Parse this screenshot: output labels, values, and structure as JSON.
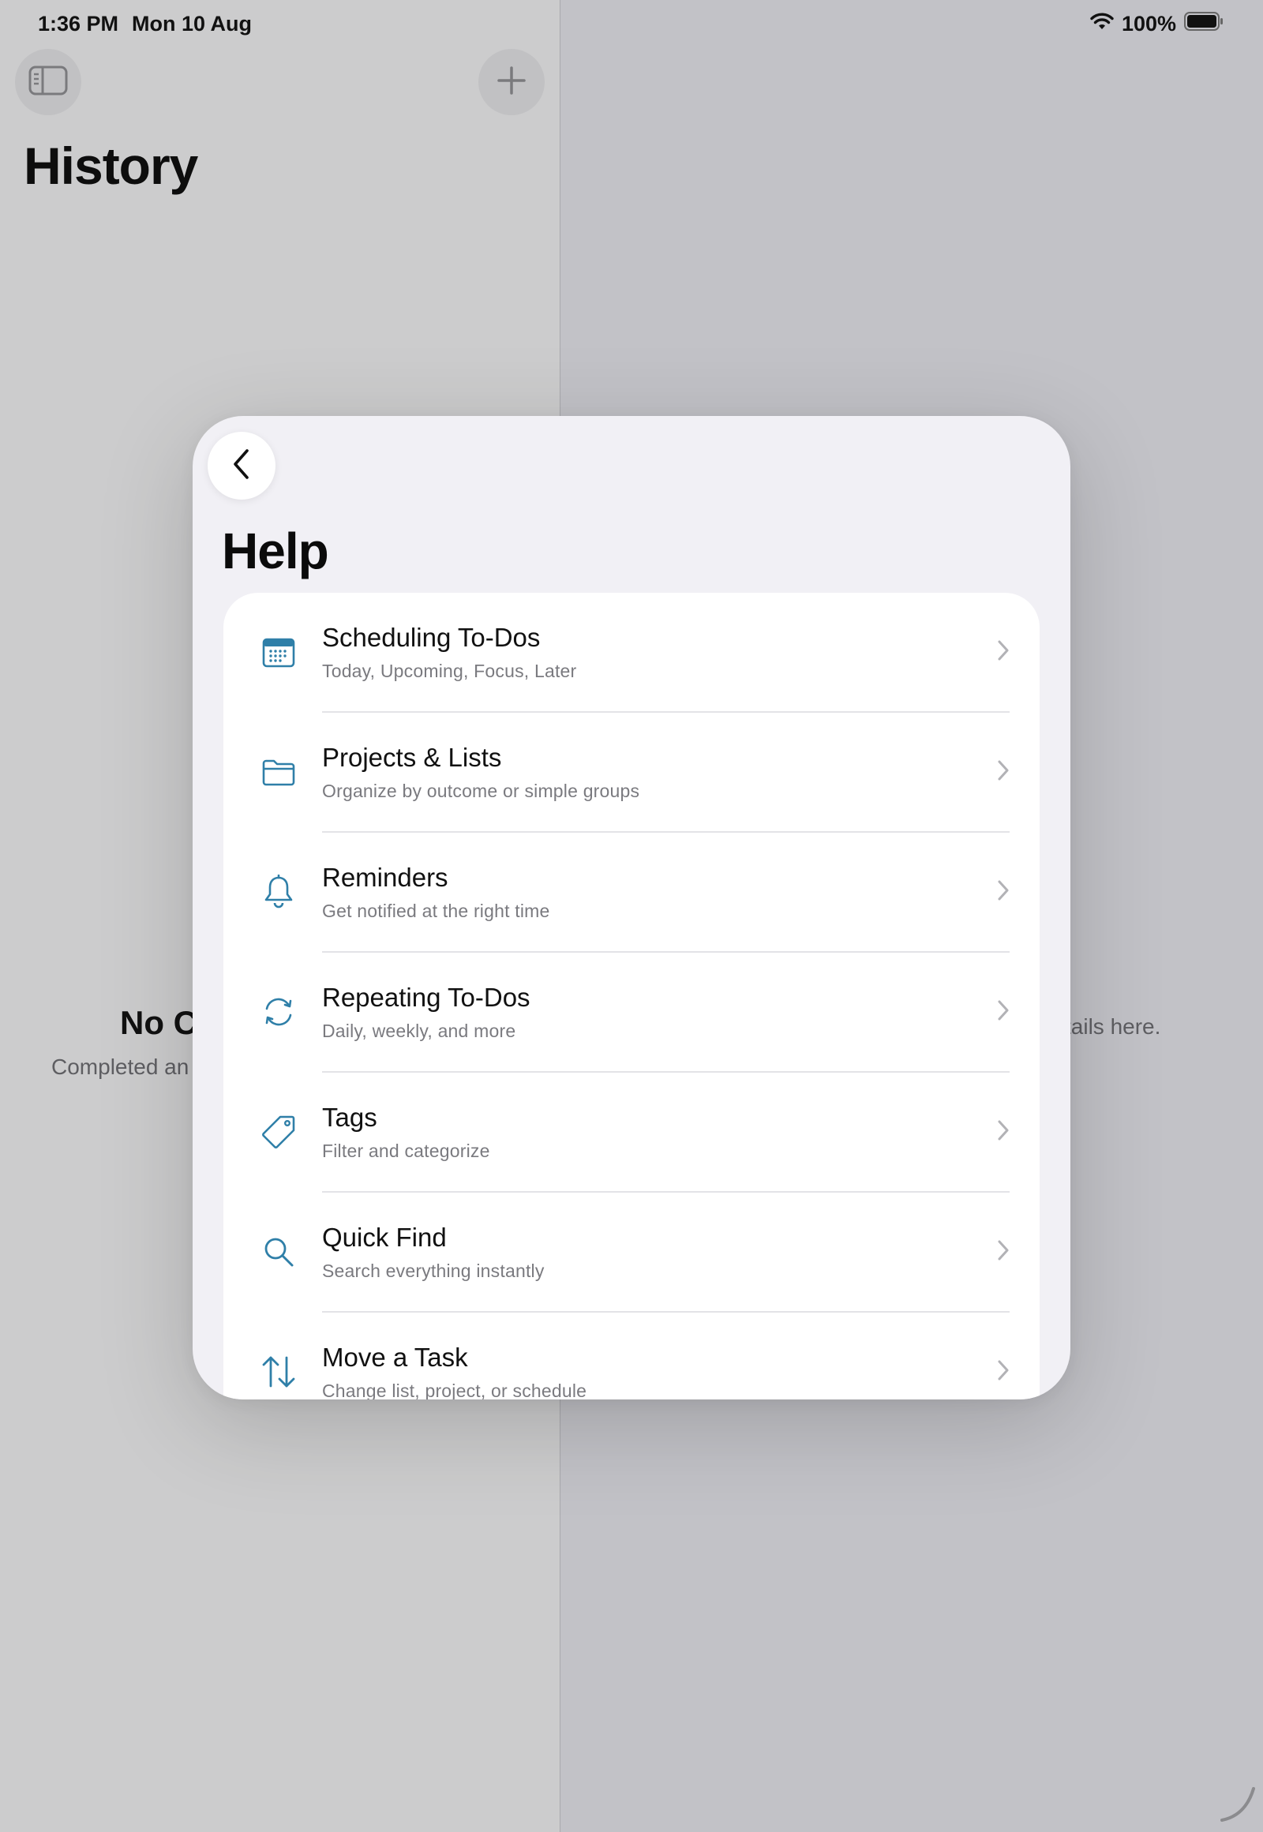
{
  "status_bar": {
    "time": "1:36 PM",
    "date": "Mon 10 Aug",
    "battery": "100%"
  },
  "background": {
    "title": "History",
    "empty_title": "No C",
    "empty_subtitle": "Completed an",
    "detail_hint": "tails here."
  },
  "help": {
    "title": "Help",
    "accent_color": "#2f7fa8",
    "items": [
      {
        "title": "Scheduling To-Dos",
        "subtitle": "Today, Upcoming, Focus, Later",
        "icon": "calendar-icon"
      },
      {
        "title": "Projects & Lists",
        "subtitle": "Organize by outcome or simple groups",
        "icon": "folder-icon"
      },
      {
        "title": "Reminders",
        "subtitle": "Get notified at the right time",
        "icon": "bell-icon"
      },
      {
        "title": "Repeating To-Dos",
        "subtitle": "Daily, weekly, and more",
        "icon": "repeat-icon"
      },
      {
        "title": "Tags",
        "subtitle": "Filter and categorize",
        "icon": "tag-icon"
      },
      {
        "title": "Quick Find",
        "subtitle": "Search everything instantly",
        "icon": "search-icon"
      },
      {
        "title": "Move a Task",
        "subtitle": "Change list, project, or schedule",
        "icon": "move-arrows-icon"
      }
    ]
  }
}
